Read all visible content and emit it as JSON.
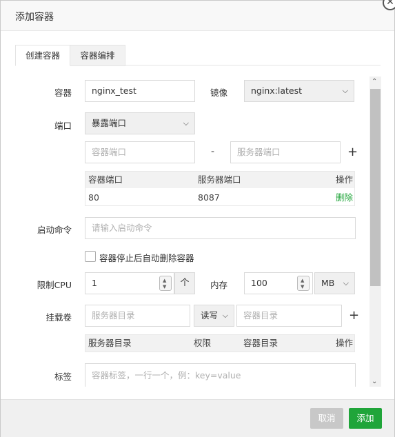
{
  "dialog": {
    "title": "添加容器",
    "close_icon": "close-icon"
  },
  "tabs": [
    {
      "label": "创建容器",
      "active": true
    },
    {
      "label": "容器编排",
      "active": false
    }
  ],
  "form": {
    "container_label": "容器",
    "container_value": "nginx_test",
    "image_label": "镜像",
    "image_value": "nginx:latest",
    "port_label": "端口",
    "port_mode_value": "暴露端口",
    "container_port_placeholder": "容器端口",
    "dash": "-",
    "server_port_placeholder": "服务器端口",
    "plus": "+",
    "port_table": {
      "headers": [
        "容器端口",
        "服务器端口",
        "操作"
      ],
      "rows": [
        {
          "container_port": "80",
          "server_port": "8087",
          "action": "删除"
        }
      ]
    },
    "command_label": "启动命令",
    "command_placeholder": "请输入启动命令",
    "auto_remove_label": "容器停止后自动删除容器",
    "auto_remove_checked": false,
    "cpu_label": "限制CPU",
    "cpu_value": "1",
    "cpu_unit": "个",
    "memory_label": "内存",
    "memory_value": "100",
    "memory_unit": "MB",
    "volume_label": "挂载卷",
    "volume_server_placeholder": "服务器目录",
    "volume_mode_value": "读写",
    "volume_container_placeholder": "容器目录",
    "volume_table": {
      "headers": [
        "服务器目录",
        "权限",
        "容器目录",
        "操作"
      ]
    },
    "tag_label": "标签",
    "tag_placeholder": "容器标签，一行一个，例：key=value"
  },
  "footer": {
    "cancel_label": "取消",
    "add_label": "添加"
  },
  "colors": {
    "accent": "#20a53a",
    "disabled": "#c8c8c8"
  }
}
